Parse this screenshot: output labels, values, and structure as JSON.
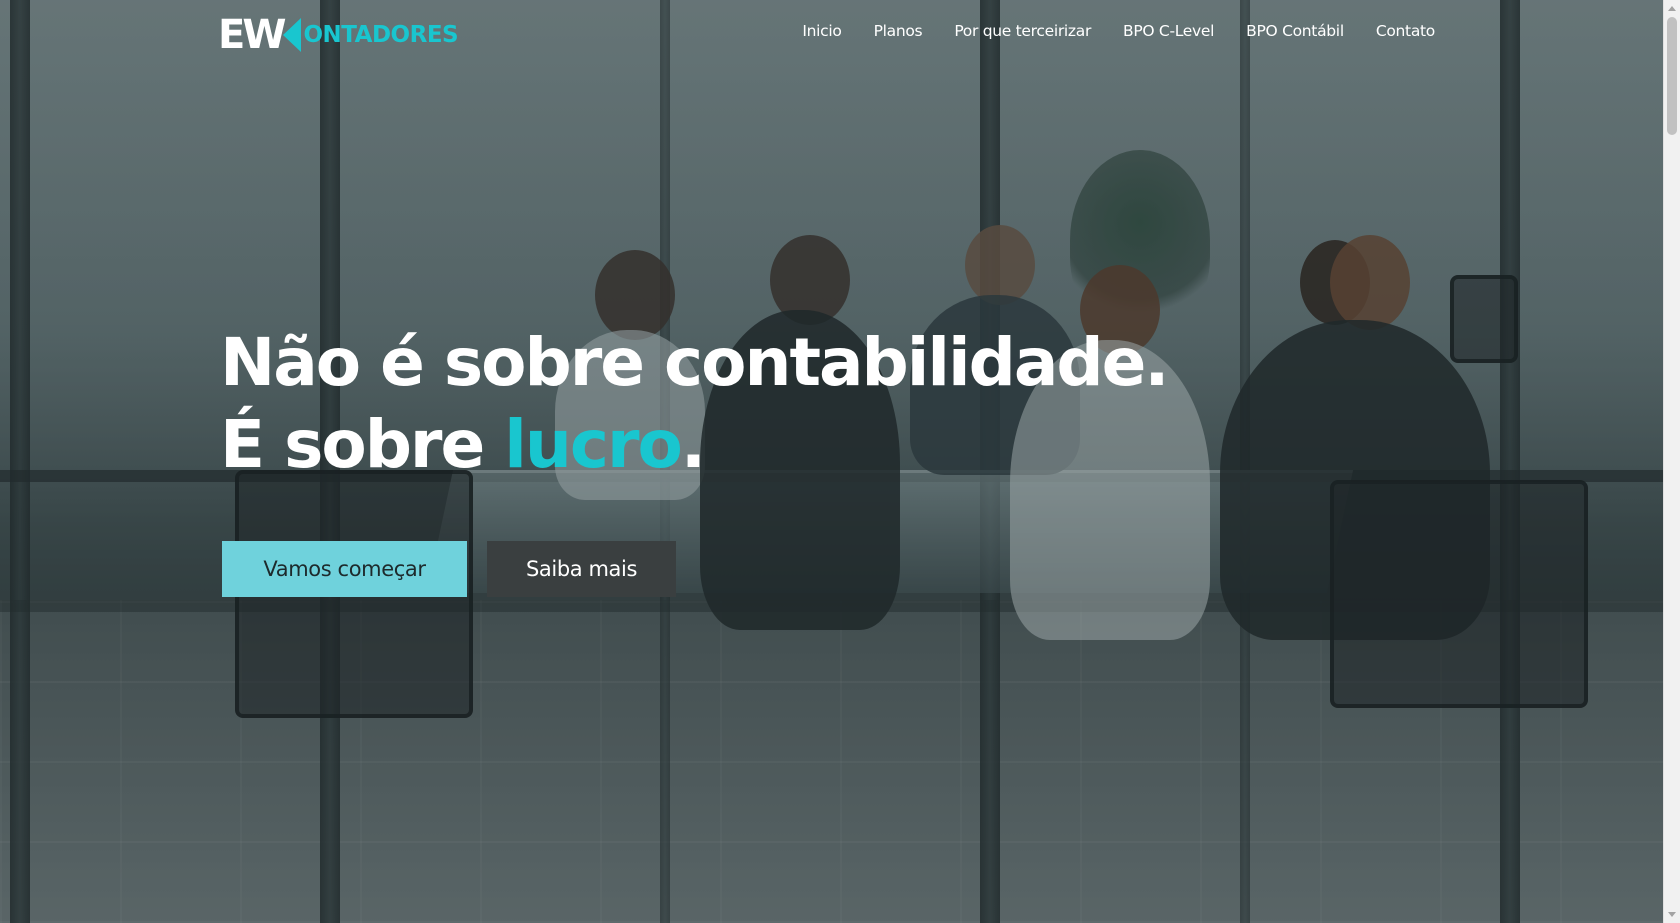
{
  "header": {
    "logo": {
      "mark": "EW",
      "word": "ONTADORES"
    },
    "nav": [
      {
        "label": "Inicio"
      },
      {
        "label": "Planos"
      },
      {
        "label": "Por que terceirizar"
      },
      {
        "label": "BPO C-Level"
      },
      {
        "label": "BPO Contábil"
      },
      {
        "label": "Contato"
      }
    ]
  },
  "hero": {
    "line1": "Não é sobre contabilidade.",
    "line2_prefix": "É sobre ",
    "line2_accent": "lucro",
    "line2_suffix": ".",
    "primary_button": "Vamos começar",
    "secondary_button": "Saiba mais"
  },
  "background": {
    "description_icon": "meeting-room-photo"
  },
  "colors": {
    "accent": "#19c6cf",
    "primary_button_bg": "#6fd2dc",
    "secondary_button_bg": "#3a3f40",
    "text": "#ffffff"
  }
}
